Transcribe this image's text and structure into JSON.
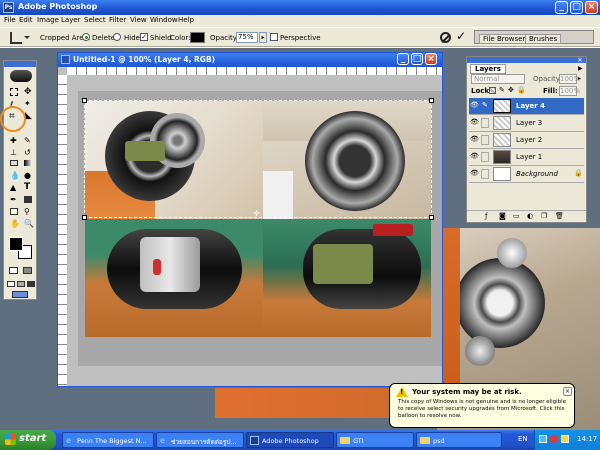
{
  "app": {
    "title": "Adobe Photoshop"
  },
  "menu": [
    "File",
    "Edit",
    "Image",
    "Layer",
    "Select",
    "Filter",
    "View",
    "Window",
    "Help"
  ],
  "options": {
    "cropped_area_label": "Cropped Area:",
    "delete_label": "Delete",
    "hide_label": "Hide",
    "shield_label": "Shield",
    "color_label": "Color:",
    "opacity_label": "Opacity:",
    "opacity_value": "75%",
    "perspective_label": "Perspective"
  },
  "palette_well": {
    "tabs": [
      "File Browser",
      "Brushes"
    ]
  },
  "document": {
    "title": "Untitled-1 @ 100% (Layer 4, RGB)"
  },
  "layers": {
    "tab": "Layers",
    "blend_mode": "Normal",
    "opacity_label": "Opacity:",
    "opacity_value": "100%",
    "lock_label": "Lock:",
    "fill_label": "Fill:",
    "fill_value": "100%",
    "items": [
      "Layer 4",
      "Layer 3",
      "Layer 2",
      "Layer 1",
      "Background"
    ]
  },
  "balloon": {
    "title": "Your system may be at risk.",
    "body": "This copy of Windows is not genuine and is no longer eligible to receive select security upgrades from Microsoft.  Click this balloon to resolve now."
  },
  "taskbar": {
    "start": "start",
    "items": [
      "Penn The Biggest N...",
      "ช่วยสอนการตัดต่อรูป...",
      "Adobe Photoshop",
      "GTI",
      "psd"
    ],
    "lang": "EN",
    "clock": "14:17"
  },
  "colors": {
    "xp_blue": "#2458d8",
    "highlight": "#316ac5",
    "tool_circle": "#f08a1c",
    "start_green": "#3a9e3a"
  }
}
